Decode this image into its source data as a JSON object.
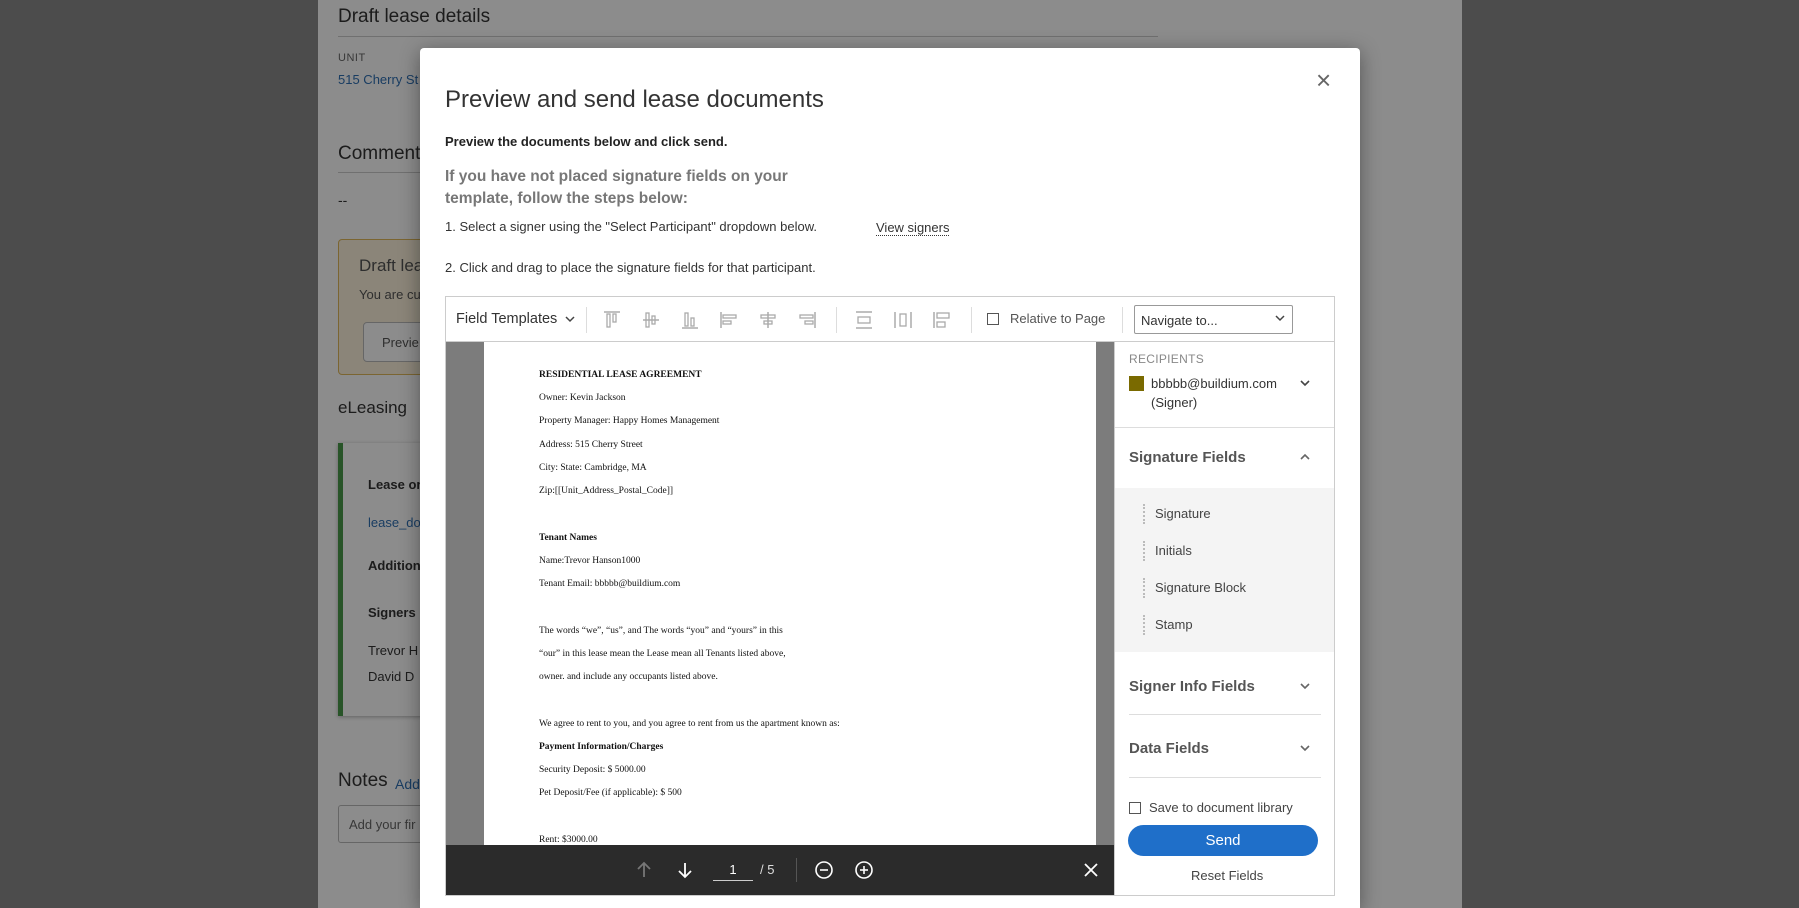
{
  "background": {
    "title": "Draft lease details",
    "unit_label": "UNIT",
    "unit_link": "515 Cherry St",
    "comments_heading": "Comment",
    "comments_value": "--",
    "draft_box_title": "Draft lea",
    "draft_box_sub": "You are cu",
    "draft_box_button": "Previe",
    "eleasing_heading": "eLeasing",
    "lease_box": {
      "lease_label": "Lease or",
      "lease_link": "lease_do",
      "additional_label": "Addition",
      "signers_label": "Signers",
      "signer_1": "Trevor H",
      "signer_2": "David D"
    },
    "notes_heading": "Notes",
    "notes_add": "Add",
    "notes_input": "Add your fir"
  },
  "modal": {
    "title": "Preview and send lease documents",
    "intro": "Preview the documents below and click send.",
    "warning": "If you have not placed signature fields on your template, follow the steps below:",
    "step1": "1. Select a signer using the \"Select Participant\" dropdown below.",
    "step2": "2. Click and drag to place the signature fields for that participant.",
    "view_signers": "View signers",
    "close_symbol": "×"
  },
  "toolbar": {
    "field_templates": "Field Templates",
    "relative_to_page": "Relative to Page",
    "navigate_to": "Navigate to..."
  },
  "document": {
    "lines": [
      {
        "text": "RESIDENTIAL LEASE AGREEMENT",
        "bold": true
      },
      {
        "text": "Owner: Kevin Jackson",
        "bold": false
      },
      {
        "text": "Property Manager: Happy Homes Management",
        "bold": false
      },
      {
        "text": "Address: 515 Cherry Street",
        "bold": false
      },
      {
        "text": "City: State: Cambridge, MA",
        "bold": false
      },
      {
        "text": "Zip:[[Unit_Address_Postal_Code]]",
        "bold": false
      },
      {
        "text": "Tenant Names",
        "bold": true
      },
      {
        "text": "Name:Trevor Hanson1000",
        "bold": false
      },
      {
        "text": "Tenant Email: bbbbb@buildium.com",
        "bold": false
      },
      {
        "text": "The words “we”, “us”, and The words “you” and “yours” in this",
        "bold": false
      },
      {
        "text": "“our” in this lease mean the Lease mean all Tenants listed above,",
        "bold": false
      },
      {
        "text": "owner. and include any occupants listed above.",
        "bold": false
      },
      {
        "text": "We agree to rent to you, and you agree to rent from us the apartment known as:",
        "bold": false
      },
      {
        "text": "Payment Information/Charges",
        "bold": true
      },
      {
        "text": "Security Deposit: $ 5000.00",
        "bold": false
      },
      {
        "text": "Pet Deposit/Fee (if applicable): $ 500",
        "bold": false
      },
      {
        "text": "Rent: $3000.00",
        "bold": false
      }
    ]
  },
  "viewer": {
    "current_page": "1",
    "total_pages": "/ 5"
  },
  "panel": {
    "recipients_label": "RECIPIENTS",
    "recipient_name": "bbbbb@buildium.com (Signer)",
    "recipient_color": "#7a6a00",
    "signature_fields": "Signature Fields",
    "signature_items": [
      "Signature",
      "Initials",
      "Signature Block",
      "Stamp"
    ],
    "signer_info_fields": "Signer Info Fields",
    "data_fields": "Data Fields",
    "save_to_library": "Save to document library",
    "send": "Send",
    "reset_fields": "Reset Fields"
  },
  "colors": {
    "accent": "#1f6fc9",
    "link": "#2f6fb3",
    "lease_border": "#4a9a4a"
  }
}
